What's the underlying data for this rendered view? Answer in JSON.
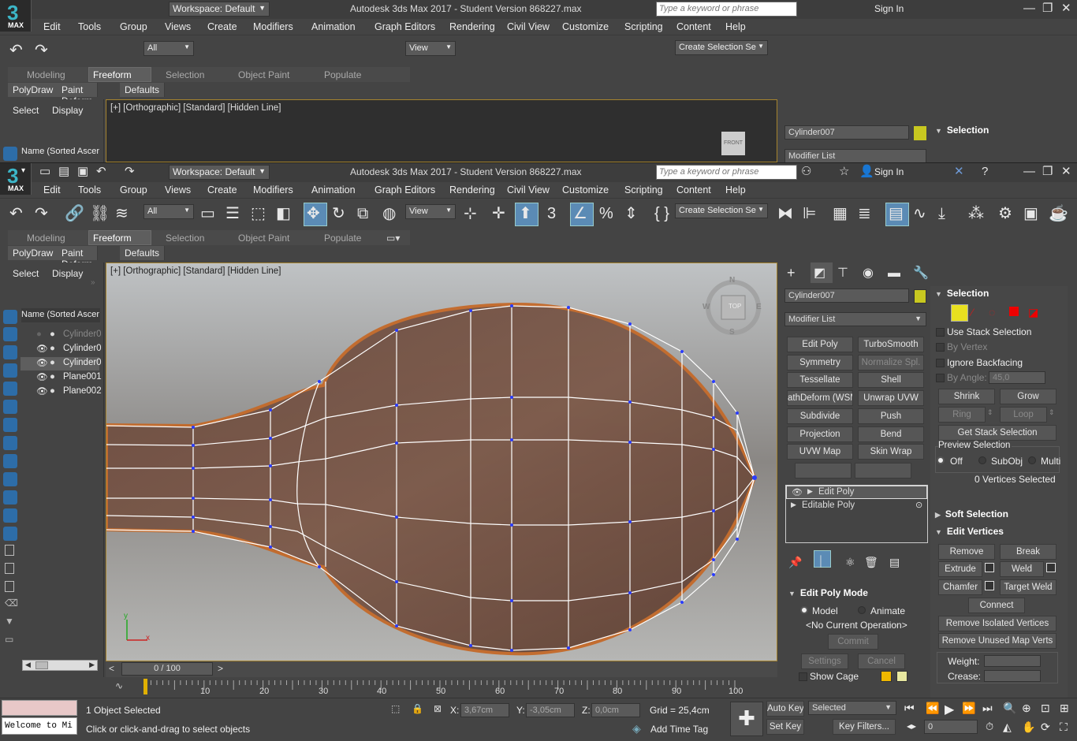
{
  "app": {
    "title": "Autodesk 3ds Max 2017 - Student Version   868227.max",
    "logo_text": "3",
    "logo_sub": "MAX",
    "workspace": "Workspace: Default",
    "search_placeholder": "Type a keyword or phrase",
    "sign_in": "Sign In"
  },
  "menu": [
    "Edit",
    "Tools",
    "Group",
    "Views",
    "Create",
    "Modifiers",
    "Animation",
    "Graph Editors",
    "Rendering",
    "Civil View",
    "Customize",
    "Scripting",
    "Content",
    "Help"
  ],
  "toolbar": {
    "filter": "All",
    "ref_coord": "View",
    "selection_set": "Create Selection Se"
  },
  "ribbon": {
    "tabs": [
      "Modeling",
      "Freeform",
      "Selection",
      "Object Paint",
      "Populate"
    ],
    "active_tab": "Freeform",
    "subtabs": [
      "PolyDraw",
      "Paint Deform",
      "Defaults"
    ]
  },
  "scene_explorer": {
    "select_label": "Select",
    "display_label": "Display",
    "column_header": "Name (Sorted Ascer",
    "items": [
      "Cylinder0",
      "Cylinder0",
      "Cylinder0",
      "Plane001",
      "Plane002"
    ]
  },
  "viewport": {
    "label": "[+] [Orthographic] [Standard] [Hidden Line]",
    "viewcube_top": "TOP",
    "viewcube_front": "FRONT",
    "compass": {
      "n": "N",
      "s": "S",
      "e": "E",
      "w": "W"
    },
    "axis_x": "x",
    "axis_y": "y"
  },
  "command_panel": {
    "object_name": "Cylinder007",
    "object_color": "#c8c820",
    "modifier_list": "Modifier List",
    "modifier_buttons": [
      "Edit Poly",
      "TurboSmooth",
      "Symmetry",
      "Normalize Spl.",
      "Tessellate",
      "Shell",
      "athDeform (WSM",
      "Unwrap UVW",
      "Subdivide",
      "Push",
      "Projection",
      "Bend",
      "UVW Map",
      "Skin Wrap"
    ],
    "stack": [
      "Edit Poly",
      "Editable Poly"
    ],
    "edit_poly_mode": {
      "title": "Edit Poly Mode",
      "model": "Model",
      "animate": "Animate",
      "no_op": "<No Current Operation>",
      "commit": "Commit",
      "settings": "Settings",
      "cancel": "Cancel",
      "show_cage": "Show Cage"
    }
  },
  "selection_rollout": {
    "title": "Selection",
    "use_stack": "Use Stack Selection",
    "by_vertex": "By Vertex",
    "ignore_backfacing": "Ignore Backfacing",
    "by_angle_label": "By Angle:",
    "by_angle_value": "45,0",
    "shrink": "Shrink",
    "grow": "Grow",
    "ring": "Ring",
    "loop": "Loop",
    "get_stack": "Get Stack Selection",
    "preview_title": "Preview Selection",
    "preview_options": [
      "Off",
      "SubObj",
      "Multi"
    ],
    "count": "0 Vertices Selected"
  },
  "soft_selection": {
    "title": "Soft Selection"
  },
  "edit_vertices": {
    "title": "Edit Vertices",
    "buttons": [
      "Remove",
      "Break",
      "Extrude",
      "Weld",
      "Chamfer",
      "Target Weld",
      "Connect",
      "Remove Isolated Vertices",
      "Remove Unused Map Verts"
    ],
    "weight_label": "Weight:",
    "crease_label": "Crease:"
  },
  "timeline": {
    "frame": "0 / 100",
    "ticks": [
      "10",
      "20",
      "30",
      "40",
      "50",
      "60",
      "70",
      "80",
      "90",
      "100"
    ],
    "prev": "<",
    "next": ">"
  },
  "status": {
    "listener": "Welcome to Mi",
    "objects_selected": "1 Object Selected",
    "prompt": "Click or click-and-drag to select objects",
    "x_label": "X:",
    "x_value": "3,67cm",
    "y_label": "Y:",
    "y_value": "-3,05cm",
    "z_label": "Z:",
    "z_value": "0,0cm",
    "grid": "Grid = 25,4cm",
    "add_time_tag": "Add Time Tag",
    "auto_key": "Auto Key",
    "set_key": "Set Key",
    "selected": "Selected",
    "key_filters": "Key Filters...",
    "frame_field": "0"
  }
}
